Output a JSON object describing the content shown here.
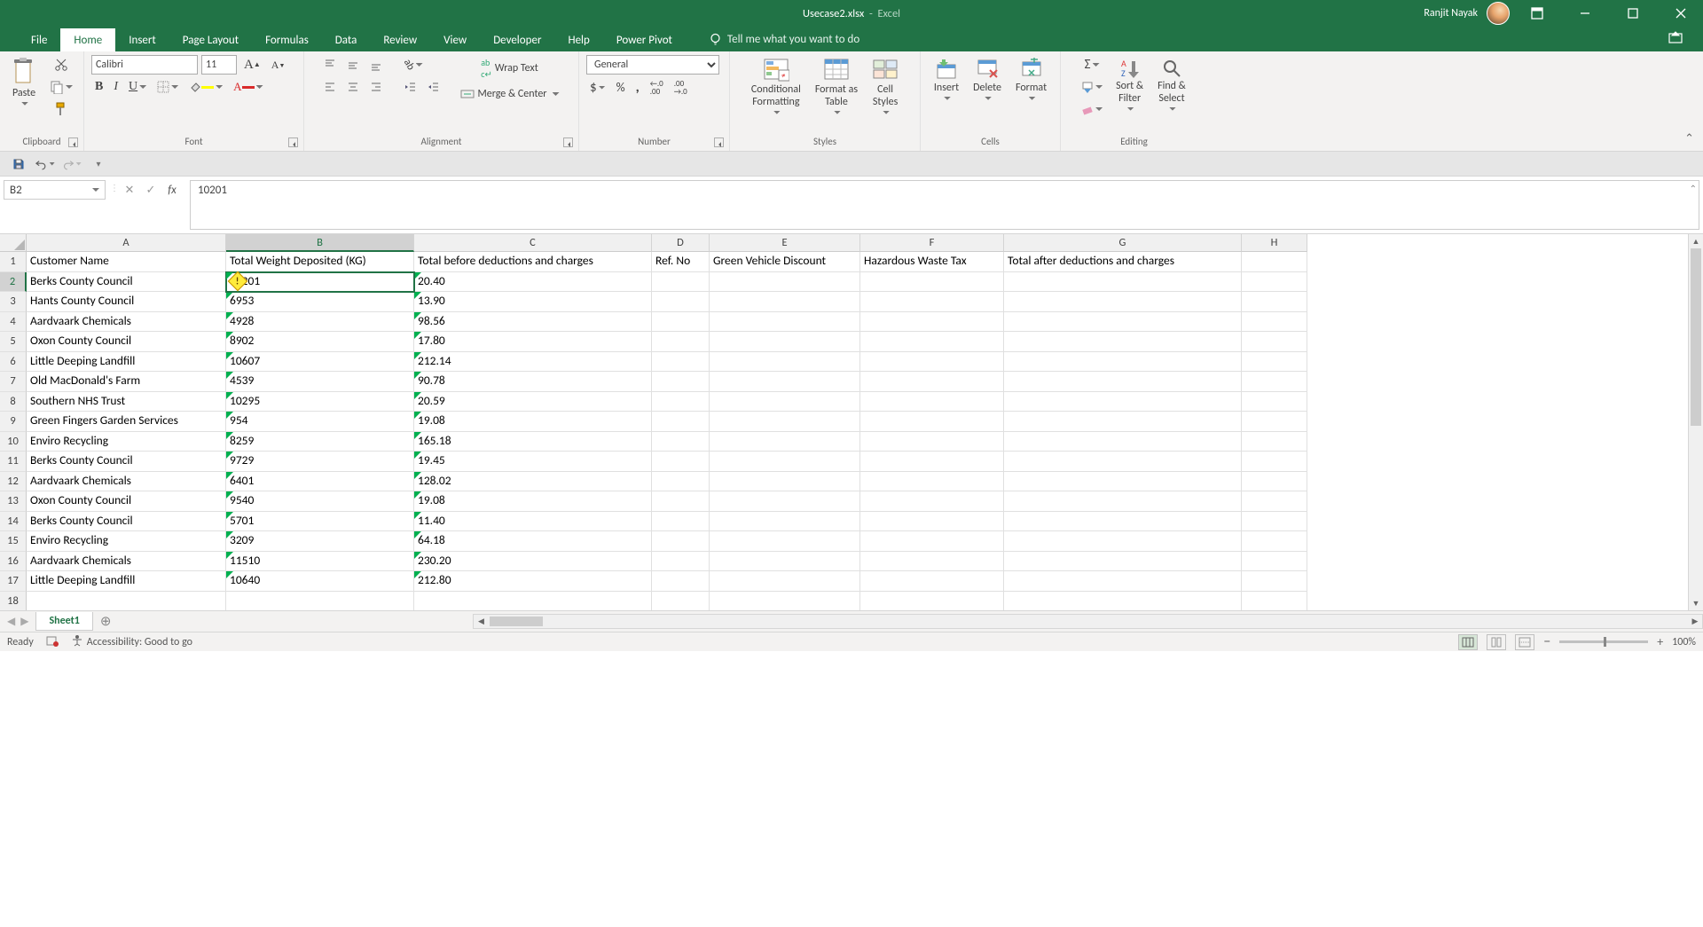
{
  "titlebar": {
    "filename": "Usecase2.xlsx",
    "app": "Excel",
    "user": "Ranjit Nayak"
  },
  "tabs": [
    "File",
    "Home",
    "Insert",
    "Page Layout",
    "Formulas",
    "Data",
    "Review",
    "View",
    "Developer",
    "Help",
    "Power Pivot"
  ],
  "active_tab": "Home",
  "tell_me": "Tell me what you want to do",
  "ribbon": {
    "clipboard": {
      "label": "Clipboard",
      "paste": "Paste"
    },
    "font": {
      "label": "Font",
      "name": "Calibri",
      "size": "11"
    },
    "alignment": {
      "label": "Alignment",
      "wrap": "Wrap Text",
      "merge": "Merge & Center"
    },
    "number": {
      "label": "Number",
      "format": "General"
    },
    "styles": {
      "label": "Styles",
      "cf": "Conditional\nFormatting",
      "fat": "Format as\nTable",
      "cs": "Cell\nStyles"
    },
    "cells": {
      "label": "Cells",
      "insert": "Insert",
      "delete": "Delete",
      "format": "Format"
    },
    "editing": {
      "label": "Editing",
      "sort": "Sort &\nFilter",
      "find": "Find &\nSelect"
    }
  },
  "namebox": "B2",
  "formula": "10201",
  "columns": [
    "A",
    "B",
    "C",
    "D",
    "E",
    "F",
    "G",
    "H"
  ],
  "selected_col": 1,
  "selected_row": 1,
  "headers": [
    "Customer Name",
    "Total Weight Deposited (KG)",
    "Total before deductions and charges",
    "Ref. No",
    "Green Vehicle Discount",
    "Hazardous Waste Tax",
    "Total after deductions and charges"
  ],
  "rows": [
    [
      "Berks County Council",
      "10201",
      "20.40",
      "",
      "",
      "",
      ""
    ],
    [
      "Hants County Council",
      "6953",
      "13.90",
      "",
      "",
      "",
      ""
    ],
    [
      "Aardvaark Chemicals",
      "4928",
      "98.56",
      "",
      "",
      "",
      ""
    ],
    [
      "Oxon County Council",
      "8902",
      "17.80",
      "",
      "",
      "",
      ""
    ],
    [
      "Little Deeping Landfill",
      "10607",
      "212.14",
      "",
      "",
      "",
      ""
    ],
    [
      "Old MacDonald's Farm",
      "4539",
      "90.78",
      "",
      "",
      "",
      ""
    ],
    [
      "Southern NHS Trust",
      "10295",
      "20.59",
      "",
      "",
      "",
      ""
    ],
    [
      "Green Fingers Garden Services",
      "954",
      "19.08",
      "",
      "",
      "",
      ""
    ],
    [
      "Enviro Recycling",
      "8259",
      "165.18",
      "",
      "",
      "",
      ""
    ],
    [
      "Berks County Council",
      "9729",
      "19.45",
      "",
      "",
      "",
      ""
    ],
    [
      "Aardvaark Chemicals",
      "6401",
      "128.02",
      "",
      "",
      "",
      ""
    ],
    [
      "Oxon County Council",
      "9540",
      "19.08",
      "",
      "",
      "",
      ""
    ],
    [
      "Berks County Council",
      "5701",
      "11.40",
      "",
      "",
      "",
      ""
    ],
    [
      "Enviro Recycling",
      "3209",
      "64.18",
      "",
      "",
      "",
      ""
    ],
    [
      "Aardvaark Chemicals",
      "11510",
      "230.20",
      "",
      "",
      "",
      ""
    ],
    [
      "Little Deeping Landfill",
      "10640",
      "212.80",
      "",
      "",
      "",
      ""
    ]
  ],
  "sheet_tab": "Sheet1",
  "status": {
    "ready": "Ready",
    "acc": "Accessibility: Good to go",
    "zoom": "100%"
  }
}
